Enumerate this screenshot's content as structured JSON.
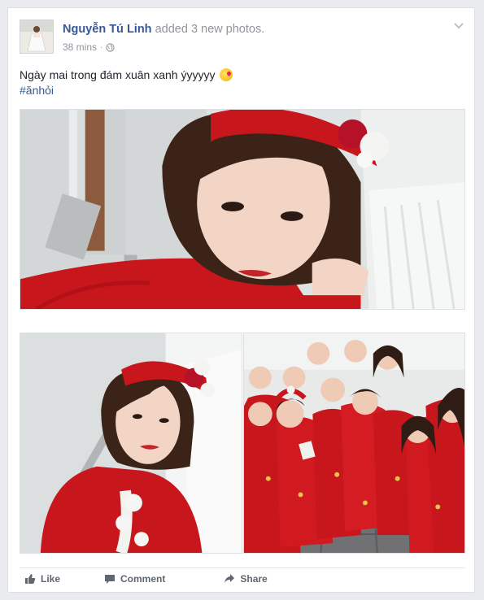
{
  "post": {
    "author_name": "Nguyễn Tú Linh",
    "action_prefix": "added",
    "photo_count": "3",
    "action_suffix": "new photos.",
    "timestamp": "38 mins",
    "separator": "·",
    "privacy_icon": "globe-icon",
    "text": "Ngày mai trong đám xuân xanh ýyyyyy",
    "emoji": "kissing-face-emoji",
    "hashtag": "#ănhỏi"
  },
  "actions": {
    "like": "Like",
    "comment": "Comment",
    "share": "Share"
  },
  "colors": {
    "link": "#365899",
    "muted": "#90949c",
    "dress_red": "#c8161d",
    "background": "#e9ebee"
  }
}
